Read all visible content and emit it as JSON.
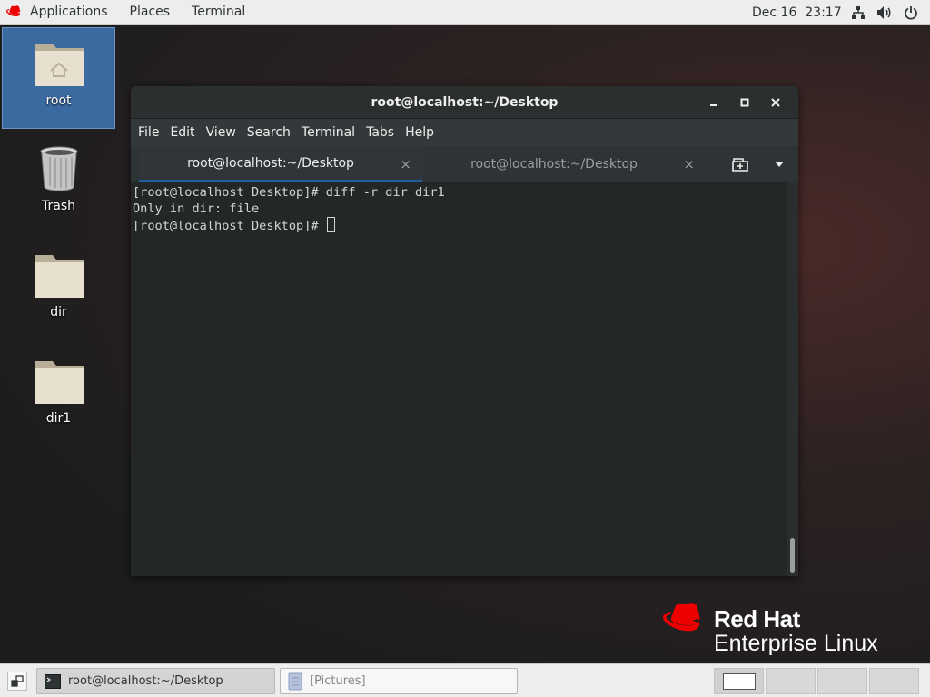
{
  "topbar": {
    "applications_label": "Applications",
    "places_label": "Places",
    "terminal_label": "Terminal",
    "clock": "Dec 16  23:17",
    "tray_icons": [
      "network-icon",
      "volume-icon",
      "power-icon"
    ]
  },
  "desktop": {
    "icons": [
      {
        "label": "root",
        "icon": "home-folder-icon",
        "selected": true
      },
      {
        "label": "Trash",
        "icon": "trash-icon",
        "selected": false
      },
      {
        "label": "dir",
        "icon": "folder-icon",
        "selected": false
      },
      {
        "label": "dir1",
        "icon": "folder-icon",
        "selected": false
      }
    ]
  },
  "terminal_window": {
    "title": "root@localhost:~/Desktop",
    "menu": [
      "File",
      "Edit",
      "View",
      "Search",
      "Terminal",
      "Tabs",
      "Help"
    ],
    "tabs": [
      {
        "label": "root@localhost:~/Desktop",
        "active": true,
        "close": "×"
      },
      {
        "label": "root@localhost:~/Desktop",
        "active": false,
        "close": "×"
      }
    ],
    "lines": [
      "[root@localhost Desktop]# diff -r dir dir1",
      "Only in dir: file",
      "[root@localhost Desktop]# "
    ]
  },
  "branding": {
    "brand": "Red Hat",
    "product": "Enterprise Linux",
    "accent": "#ee0000"
  },
  "taskbar": {
    "tasks": [
      {
        "label": "root@localhost:~/Desktop",
        "active": true,
        "icon": "terminal-icon"
      },
      {
        "label": "[Pictures]",
        "active": false,
        "icon": "file-manager-icon"
      }
    ],
    "workspace_count": 4,
    "current_workspace": 1
  }
}
